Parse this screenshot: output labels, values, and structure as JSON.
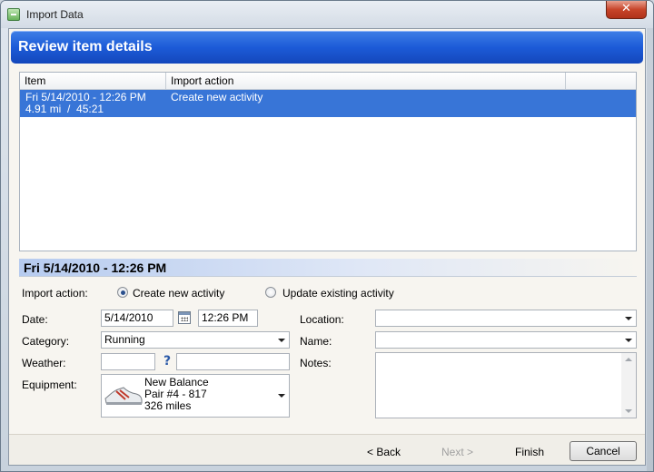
{
  "window": {
    "title": "Import Data",
    "close_glyph": "✕"
  },
  "header": {
    "title": "Review item details"
  },
  "list": {
    "columns": [
      "Item",
      "Import action"
    ],
    "rows": [
      {
        "item_line1": "Fri 5/14/2010 - 12:26 PM",
        "item_line2": "4.91 mi  /  45:21",
        "action": "Create new activity"
      }
    ]
  },
  "detail": {
    "title": "Fri 5/14/2010 - 12:26 PM",
    "import_action_label": "Import action:",
    "option_create": "Create new activity",
    "option_update": "Update existing activity",
    "selected_option": "create",
    "date_label": "Date:",
    "date_value": "5/14/2010",
    "time_value": "12:26 PM",
    "category_label": "Category:",
    "category_value": "Running",
    "weather_label": "Weather:",
    "weather_value": "",
    "weather_text": "",
    "equipment_label": "Equipment:",
    "equipment": {
      "name": "New Balance",
      "pair": "Pair #4 - 817",
      "miles": "326 miles"
    },
    "location_label": "Location:",
    "location_value": "",
    "name_label": "Name:",
    "name_value": "",
    "notes_label": "Notes:",
    "notes_value": ""
  },
  "footer": {
    "back": "< Back",
    "next": "Next >",
    "finish": "Finish",
    "cancel": "Cancel"
  },
  "colors": {
    "banner": "#1c5bd8",
    "selection": "#3875d7"
  },
  "icons": {
    "app": "import-icon",
    "calendar": "calendar-icon",
    "help": "help-icon",
    "equipment": "shoe-icon"
  }
}
